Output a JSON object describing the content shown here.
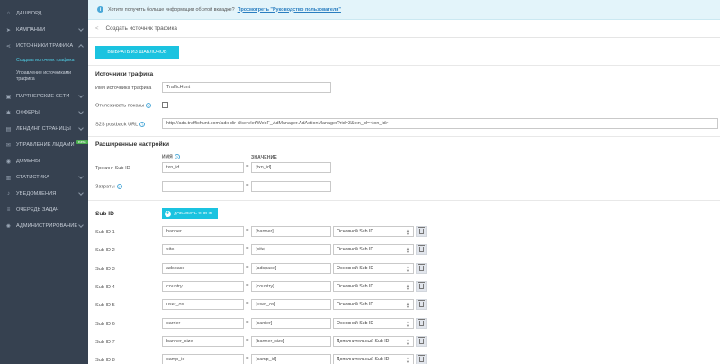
{
  "sidebar": {
    "items": [
      {
        "label": "ДАШБОРД",
        "icon": "home-icon"
      },
      {
        "label": "КАМПАНИИ",
        "icon": "rocket-icon"
      },
      {
        "label": "ИСТОЧНИКИ ТРАФИКА",
        "icon": "share-icon"
      },
      {
        "label": "ПАРТНЕРСКИЕ СЕТИ",
        "icon": "briefcase-icon"
      },
      {
        "label": "ОФФЕРЫ",
        "icon": "gear-icon"
      },
      {
        "label": "ЛЕНДИНГ СТРАНИЦЫ",
        "icon": "document-icon"
      },
      {
        "label": "УПРАВЛЕНИЕ ЛИДАМИ",
        "icon": "envelope-icon"
      },
      {
        "label": "ДОМЕНЫ",
        "icon": "globe-icon"
      },
      {
        "label": "СТАТИСТИКА",
        "icon": "bar-chart-icon"
      },
      {
        "label": "УВЕДОМЛЕНИЯ",
        "icon": "bell-icon"
      },
      {
        "label": "ОЧЕРЕДЬ ЗАДАЧ",
        "icon": "list-icon"
      },
      {
        "label": "АДМИНИСТРИРОВАНИЕ",
        "icon": "cog-icon"
      }
    ],
    "sub_create": "Создать источник трафика",
    "sub_manage": "Управление источниками трафика",
    "beta_badge": "Beta"
  },
  "banner": {
    "text": "Хотите получить больше информации об этой вкладке?",
    "link": "Просмотреть \"Руководство пользователя\""
  },
  "breadcrumb": {
    "title": "Создать источник трафика"
  },
  "main": {
    "templates_button": "ВЫБРАТЬ ИЗ ШАБЛОНОВ",
    "section_sources": "Источники трафика",
    "name_label": "Имя источника трафика",
    "name_value": "TrafficHunt",
    "track_label": "Отслеживать показы",
    "postback_label": "S2S postback URL",
    "postback_value": "http://ads.traffichunt.com/adx-dir-d/servlet/WebF_AdManager.AdActionManager?rid=3&txn_id=<txn_id>",
    "section_advanced": "Расширенные настройки",
    "col_name": "ИМЯ",
    "col_value": "ЗНАЧЕНИЕ",
    "tracking_label": "Трекинг Sub ID",
    "tracking_name": "txn_id",
    "tracking_value": "[txn_id]",
    "costs_label": "Затраты",
    "section_subid": "Sub ID",
    "add_subid_button": "ДОБАВИТЬ SUB ID"
  },
  "subids": [
    {
      "label": "Sub ID 1",
      "name": "banner",
      "value": "[banner]",
      "type": "Основной Sub ID"
    },
    {
      "label": "Sub ID 2",
      "name": "site",
      "value": "[site]",
      "type": "Основной Sub ID"
    },
    {
      "label": "Sub ID 3",
      "name": "adspace",
      "value": "[adspace]",
      "type": "Основной Sub ID"
    },
    {
      "label": "Sub ID 4",
      "name": "country",
      "value": "[country]",
      "type": "Основной Sub ID"
    },
    {
      "label": "Sub ID 5",
      "name": "user_os",
      "value": "[user_os]",
      "type": "Основной Sub ID"
    },
    {
      "label": "Sub ID 6",
      "name": "carrier",
      "value": "[carrier]",
      "type": "Основной Sub ID"
    },
    {
      "label": "Sub ID 7",
      "name": "banner_size",
      "value": "[banner_size]",
      "type": "Дополнительный Sub ID"
    },
    {
      "label": "Sub ID 8",
      "name": "camp_id",
      "value": "[camp_id]",
      "type": "Дополнительный Sub ID"
    }
  ],
  "colors": {
    "sidebar": "#364150",
    "accent": "#1bc3e0",
    "active_link": "#4fd1e8"
  }
}
